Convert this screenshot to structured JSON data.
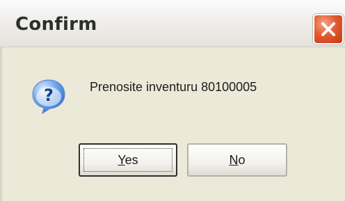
{
  "dialog": {
    "title": "Confirm",
    "message": "Prenosite inventuru 80100005",
    "icon": "question-icon",
    "close_icon": "close-icon"
  },
  "buttons": {
    "yes": {
      "accel": "Y",
      "rest": "es"
    },
    "no": {
      "accel": "N",
      "rest": "o"
    }
  },
  "colors": {
    "dialog_bg": "#ece9d8",
    "close_red": "#e35a30",
    "question_blue": "#2f6fd0"
  }
}
